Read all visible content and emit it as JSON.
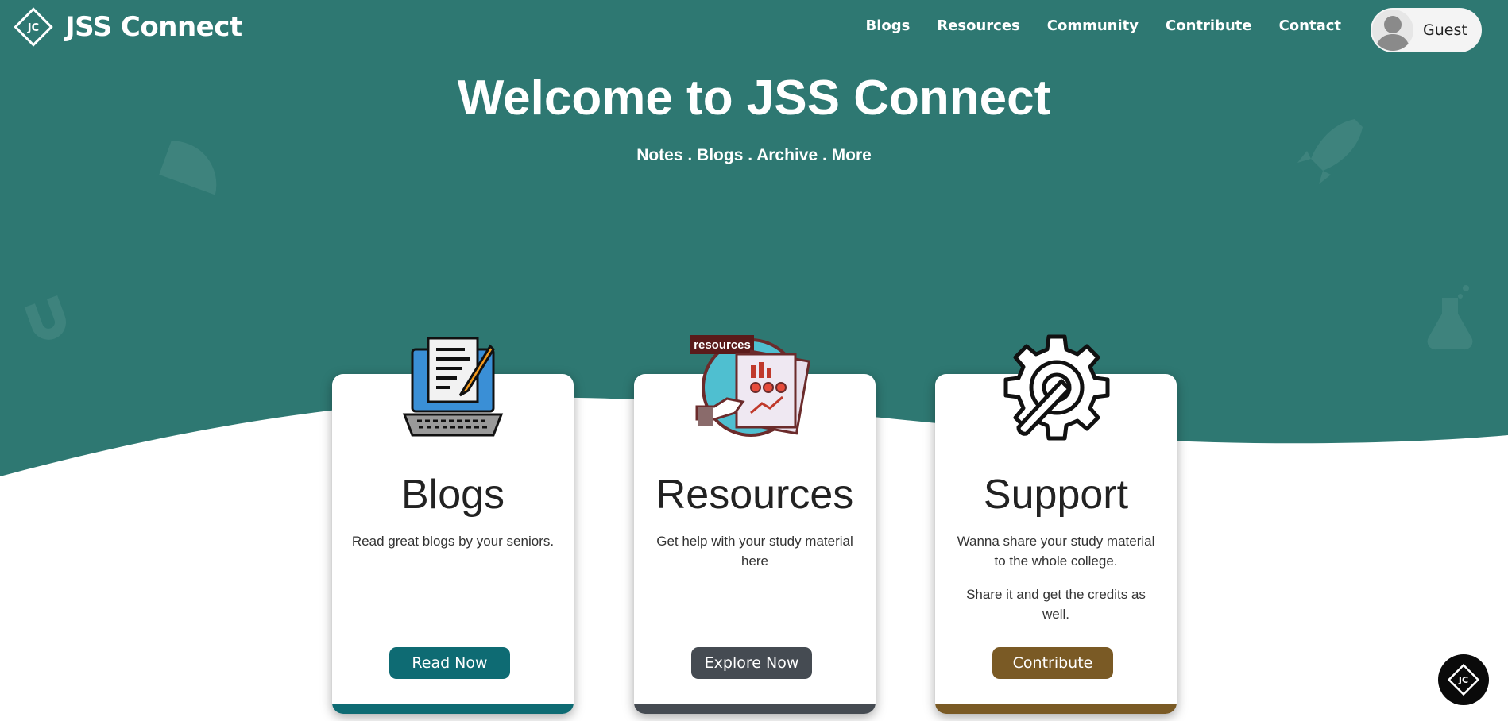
{
  "brand": {
    "name": "JSS Connect",
    "logo_text": "JC"
  },
  "nav": {
    "links": [
      "Blogs",
      "Resources",
      "Community",
      "Contribute",
      "Contact"
    ],
    "user_label": "Guest"
  },
  "hero": {
    "title": "Welcome to JSS Connect",
    "subtitle": "Notes . Blogs . Archive . More"
  },
  "cards": [
    {
      "title": "Blogs",
      "desc": [
        "Read great blogs by your seniors."
      ],
      "button": "Read Now",
      "icon": "laptop-notes-icon",
      "icon_label": "",
      "accent": "#0e6b73"
    },
    {
      "title": "Resources",
      "desc": [
        "Get help with your study material here"
      ],
      "button": "Explore Now",
      "icon": "resources-report-icon",
      "icon_label": "resources",
      "accent": "#454b52"
    },
    {
      "title": "Support",
      "desc": [
        "Wanna share your study material to the whole college.",
        "Share it and get the credits as well."
      ],
      "button": "Contribute",
      "icon": "gear-wrench-icon",
      "icon_label": "",
      "accent": "#7a5a25"
    }
  ],
  "colors": {
    "hero_bg": "#2e7872",
    "page_bg": "#ffffff"
  },
  "fab": {
    "icon": "jc-logo-icon"
  }
}
